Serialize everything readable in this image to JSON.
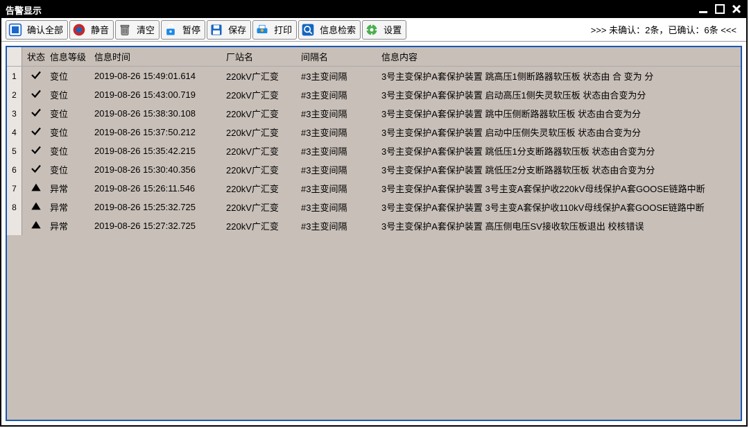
{
  "window": {
    "title": "告警显示"
  },
  "toolbar": {
    "confirm_all": "确认全部",
    "mute": "静音",
    "clear": "清空",
    "pause": "暂停",
    "save": "保存",
    "print": "打印",
    "search": "信息检索",
    "settings": "设置"
  },
  "status_bar": ">>> 未确认：2条，已确认：6条 <<<",
  "columns": {
    "status": "状态",
    "level": "信息等级",
    "time": "信息时间",
    "station": "厂站名",
    "bay": "间隔名",
    "content": "信息内容"
  },
  "rows": [
    {
      "n": "1",
      "icon": "check",
      "level": "变位",
      "time": "2019-08-26 15:49:01.614",
      "station": "220kV广汇变",
      "bay": "#3主变间隔",
      "content": "3号主变保护A套保护装置 跳高压1侧断路器软压板 状态由 合 变为 分"
    },
    {
      "n": "2",
      "icon": "check",
      "level": "变位",
      "time": "2019-08-26 15:43:00.719",
      "station": "220kV广汇变",
      "bay": "#3主变间隔",
      "content": "3号主变保护A套保护装置 启动高压1侧失灵软压板 状态由合变为分"
    },
    {
      "n": "3",
      "icon": "check",
      "level": "变位",
      "time": "2019-08-26 15:38:30.108",
      "station": "220kV广汇变",
      "bay": "#3主变间隔",
      "content": "3号主变保护A套保护装置 跳中压侧断路器软压板 状态由合变为分"
    },
    {
      "n": "4",
      "icon": "check",
      "level": "变位",
      "time": "2019-08-26 15:37:50.212",
      "station": "220kV广汇变",
      "bay": "#3主变间隔",
      "content": "3号主变保护A套保护装置 启动中压侧失灵软压板 状态由合变为分"
    },
    {
      "n": "5",
      "icon": "check",
      "level": "变位",
      "time": "2019-08-26 15:35:42.215",
      "station": "220kV广汇变",
      "bay": "#3主变间隔",
      "content": "3号主变保护A套保护装置 跳低压1分支断路器软压板 状态由合变为分"
    },
    {
      "n": "6",
      "icon": "check",
      "level": "变位",
      "time": "2019-08-26 15:30:40.356",
      "station": "220kV广汇变",
      "bay": "#3主变间隔",
      "content": "3号主变保护A套保护装置 跳低压2分支断路器软压板 状态由合变为分"
    },
    {
      "n": "7",
      "icon": "tri",
      "level": "异常",
      "time": "2019-08-26 15:26:11.546",
      "station": "220kV广汇变",
      "bay": "#3主变间隔",
      "content": "3号主变保护A套保护装置 3号主变A套保护收220kV母线保护A套GOOSE链路中断"
    },
    {
      "n": "8",
      "icon": "tri",
      "level": "异常",
      "time": "2019-08-26 15:25:32.725",
      "station": "220kV广汇变",
      "bay": "#3主变间隔",
      "content": "3号主变保护A套保护装置 3号主变A套保护收110kV母线保护A套GOOSE链路中断"
    },
    {
      "n": "",
      "icon": "tri",
      "level": "异常",
      "time": "2019-08-26 15:27:32.725",
      "station": "220kV广汇变",
      "bay": "#3主变间隔",
      "content": "3号主变保护A套保护装置 高压侧电压SV接收软压板退出 校核错误"
    }
  ]
}
